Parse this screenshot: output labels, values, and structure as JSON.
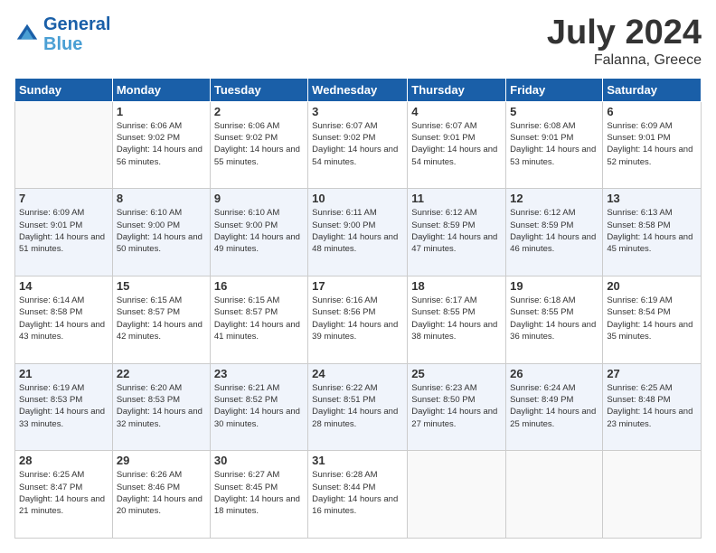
{
  "header": {
    "logo_line1": "General",
    "logo_line2": "Blue",
    "month": "July 2024",
    "location": "Falanna, Greece"
  },
  "weekdays": [
    "Sunday",
    "Monday",
    "Tuesday",
    "Wednesday",
    "Thursday",
    "Friday",
    "Saturday"
  ],
  "weeks": [
    [
      {
        "day": "",
        "empty": true
      },
      {
        "day": "1",
        "sunrise": "6:06 AM",
        "sunset": "9:02 PM",
        "daylight": "14 hours and 56 minutes."
      },
      {
        "day": "2",
        "sunrise": "6:06 AM",
        "sunset": "9:02 PM",
        "daylight": "14 hours and 55 minutes."
      },
      {
        "day": "3",
        "sunrise": "6:07 AM",
        "sunset": "9:02 PM",
        "daylight": "14 hours and 54 minutes."
      },
      {
        "day": "4",
        "sunrise": "6:07 AM",
        "sunset": "9:01 PM",
        "daylight": "14 hours and 54 minutes."
      },
      {
        "day": "5",
        "sunrise": "6:08 AM",
        "sunset": "9:01 PM",
        "daylight": "14 hours and 53 minutes."
      },
      {
        "day": "6",
        "sunrise": "6:09 AM",
        "sunset": "9:01 PM",
        "daylight": "14 hours and 52 minutes."
      }
    ],
    [
      {
        "day": "7",
        "sunrise": "6:09 AM",
        "sunset": "9:01 PM",
        "daylight": "14 hours and 51 minutes."
      },
      {
        "day": "8",
        "sunrise": "6:10 AM",
        "sunset": "9:00 PM",
        "daylight": "14 hours and 50 minutes."
      },
      {
        "day": "9",
        "sunrise": "6:10 AM",
        "sunset": "9:00 PM",
        "daylight": "14 hours and 49 minutes."
      },
      {
        "day": "10",
        "sunrise": "6:11 AM",
        "sunset": "9:00 PM",
        "daylight": "14 hours and 48 minutes."
      },
      {
        "day": "11",
        "sunrise": "6:12 AM",
        "sunset": "8:59 PM",
        "daylight": "14 hours and 47 minutes."
      },
      {
        "day": "12",
        "sunrise": "6:12 AM",
        "sunset": "8:59 PM",
        "daylight": "14 hours and 46 minutes."
      },
      {
        "day": "13",
        "sunrise": "6:13 AM",
        "sunset": "8:58 PM",
        "daylight": "14 hours and 45 minutes."
      }
    ],
    [
      {
        "day": "14",
        "sunrise": "6:14 AM",
        "sunset": "8:58 PM",
        "daylight": "14 hours and 43 minutes."
      },
      {
        "day": "15",
        "sunrise": "6:15 AM",
        "sunset": "8:57 PM",
        "daylight": "14 hours and 42 minutes."
      },
      {
        "day": "16",
        "sunrise": "6:15 AM",
        "sunset": "8:57 PM",
        "daylight": "14 hours and 41 minutes."
      },
      {
        "day": "17",
        "sunrise": "6:16 AM",
        "sunset": "8:56 PM",
        "daylight": "14 hours and 39 minutes."
      },
      {
        "day": "18",
        "sunrise": "6:17 AM",
        "sunset": "8:55 PM",
        "daylight": "14 hours and 38 minutes."
      },
      {
        "day": "19",
        "sunrise": "6:18 AM",
        "sunset": "8:55 PM",
        "daylight": "14 hours and 36 minutes."
      },
      {
        "day": "20",
        "sunrise": "6:19 AM",
        "sunset": "8:54 PM",
        "daylight": "14 hours and 35 minutes."
      }
    ],
    [
      {
        "day": "21",
        "sunrise": "6:19 AM",
        "sunset": "8:53 PM",
        "daylight": "14 hours and 33 minutes."
      },
      {
        "day": "22",
        "sunrise": "6:20 AM",
        "sunset": "8:53 PM",
        "daylight": "14 hours and 32 minutes."
      },
      {
        "day": "23",
        "sunrise": "6:21 AM",
        "sunset": "8:52 PM",
        "daylight": "14 hours and 30 minutes."
      },
      {
        "day": "24",
        "sunrise": "6:22 AM",
        "sunset": "8:51 PM",
        "daylight": "14 hours and 28 minutes."
      },
      {
        "day": "25",
        "sunrise": "6:23 AM",
        "sunset": "8:50 PM",
        "daylight": "14 hours and 27 minutes."
      },
      {
        "day": "26",
        "sunrise": "6:24 AM",
        "sunset": "8:49 PM",
        "daylight": "14 hours and 25 minutes."
      },
      {
        "day": "27",
        "sunrise": "6:25 AM",
        "sunset": "8:48 PM",
        "daylight": "14 hours and 23 minutes."
      }
    ],
    [
      {
        "day": "28",
        "sunrise": "6:25 AM",
        "sunset": "8:47 PM",
        "daylight": "14 hours and 21 minutes."
      },
      {
        "day": "29",
        "sunrise": "6:26 AM",
        "sunset": "8:46 PM",
        "daylight": "14 hours and 20 minutes."
      },
      {
        "day": "30",
        "sunrise": "6:27 AM",
        "sunset": "8:45 PM",
        "daylight": "14 hours and 18 minutes."
      },
      {
        "day": "31",
        "sunrise": "6:28 AM",
        "sunset": "8:44 PM",
        "daylight": "14 hours and 16 minutes."
      },
      {
        "day": "",
        "empty": true
      },
      {
        "day": "",
        "empty": true
      },
      {
        "day": "",
        "empty": true
      }
    ]
  ]
}
